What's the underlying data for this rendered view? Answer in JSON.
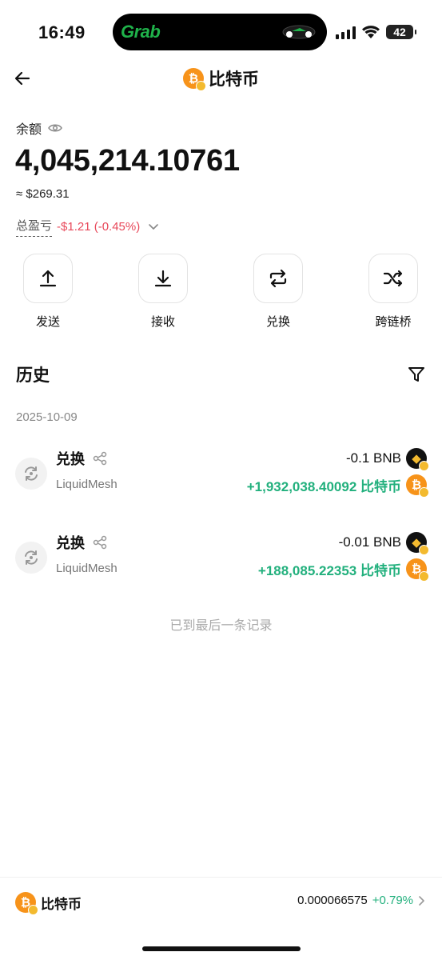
{
  "status_bar": {
    "time": "16:49",
    "island_app": "Grab",
    "battery": "42"
  },
  "header": {
    "title": "比特币",
    "coin_glyph": "₿"
  },
  "balance": {
    "label": "余额",
    "amount": "4,045,214.10761",
    "usd": "≈ $269.31",
    "pnl_label": "总盈亏",
    "pnl_value": "-$1.21 (-0.45%)"
  },
  "actions": [
    {
      "label": "发送",
      "icon": "upload-icon"
    },
    {
      "label": "接收",
      "icon": "download-icon"
    },
    {
      "label": "兑换",
      "icon": "swap-icon"
    },
    {
      "label": "跨链桥",
      "icon": "shuffle-icon"
    }
  ],
  "history": {
    "title": "历史",
    "date": "2025-10-09",
    "transactions": [
      {
        "type": "兑换",
        "from": "LiquidMesh",
        "out": "-0.1 BNB",
        "in": "+1,932,038.40092 比特币"
      },
      {
        "type": "兑换",
        "from": "LiquidMesh",
        "out": "-0.01 BNB",
        "in": "+188,085.22353 比特币"
      }
    ],
    "end_text": "已到最后一条记录"
  },
  "bottom_bar": {
    "name": "比特币",
    "price": "0.000066575",
    "change": "+0.79%"
  },
  "colors": {
    "bitcoin": "#f7931a",
    "bnb": "#f3ba2f",
    "positive": "#22b07d",
    "negative": "#e8485a"
  }
}
